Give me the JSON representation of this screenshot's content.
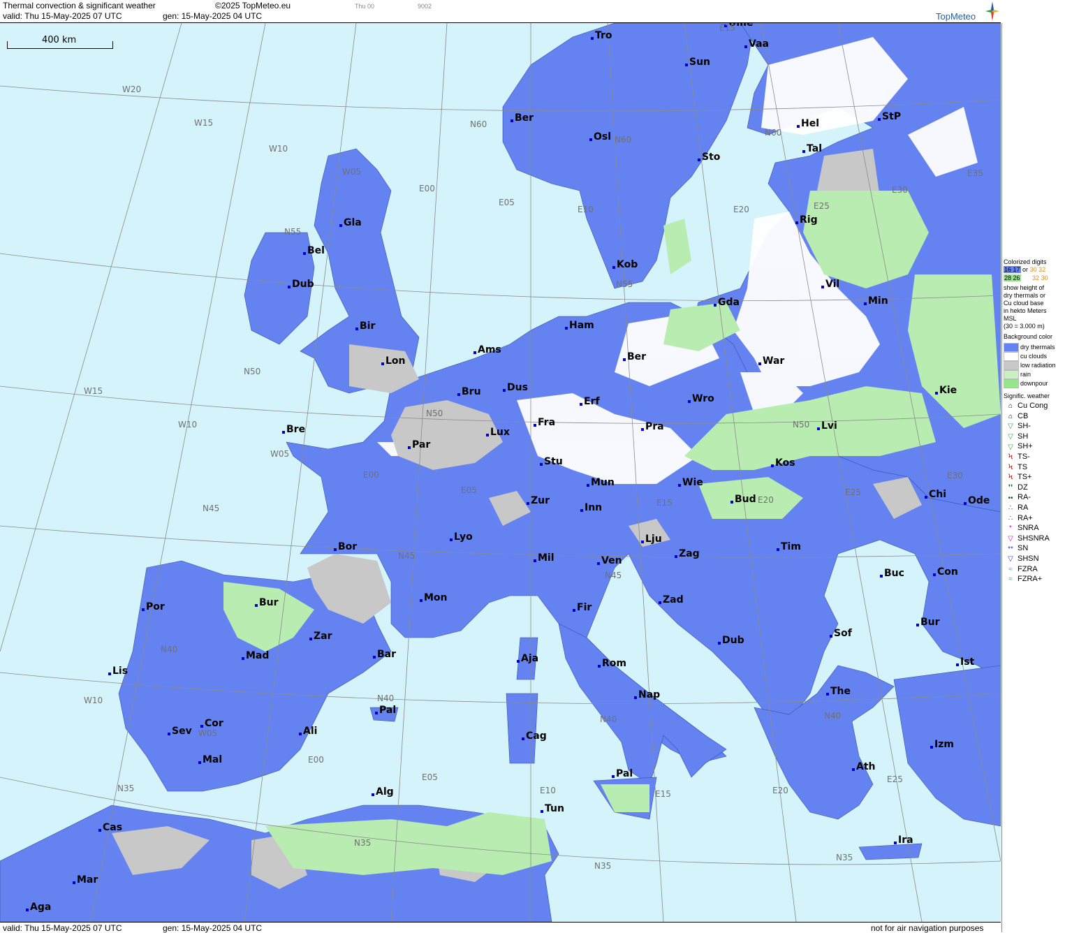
{
  "header": {
    "title": "Thermal convection & significant weather",
    "valid": "valid:  Thu   15-May-2025  07 UTC",
    "gen": "gen: 15-May-2025 04 UTC",
    "copyright": "©2025 TopMeteo.eu",
    "run": "Thu 00",
    "code": "9002",
    "logo": "TopMeteo"
  },
  "footer": {
    "valid": "valid:  Thu   15-May-2025  07 UTC",
    "gen": "gen: 15-May-2025 04 UTC",
    "disclaimer": "not for air navigation purposes"
  },
  "scale": "400 km",
  "colors": {
    "sea": "#d5f3fb",
    "dry_thermals": "#6483f0",
    "cu_clouds": "#ffffff",
    "low_radiation": "#c8c8c8",
    "rain": "#c8f0c0",
    "downpour": "#96e68c"
  },
  "legend": {
    "colorized_title": "Colorized digits",
    "digits_a": "16 17",
    "digits_or": "or",
    "digits_b": "30 32",
    "digits_c": "28 26",
    "digits_d": "32 30",
    "desc1": "show height of",
    "desc2": "dry thermals or",
    "desc3": "Cu cloud base",
    "desc4": "in hekto Meters",
    "desc5": "MSL",
    "desc6": "(30 = 3.000 m)",
    "bg_title": "Background color",
    "bg_items": [
      "dry thermals",
      "cu clouds",
      "low radiation",
      "rain",
      "downpour"
    ],
    "wx_title": "Signific. weather",
    "wx_items": [
      "Cu Cong",
      "CB",
      "SH-",
      "SH",
      "SH+",
      "TS-",
      "TS",
      "TS+",
      "DZ",
      "RA-",
      "RA",
      "RA+",
      "SNRA",
      "SHSNRA",
      "SN",
      "SHSN",
      "FZRA",
      "FZRA+"
    ]
  },
  "cities": [
    "Tro",
    "Ume",
    "Vaa",
    "Sun",
    "Ber",
    "Osl",
    "Hel",
    "StP",
    "Sto",
    "Tal",
    "Gla",
    "Bel",
    "Dub",
    "Rig",
    "Kob",
    "Gda",
    "Vil",
    "Min",
    "Bir",
    "Ham",
    "Ams",
    "Lon",
    "Ber",
    "War",
    "Dus",
    "Bru",
    "Erf",
    "Wro",
    "Kie",
    "Bre",
    "Lux",
    "Fra",
    "Pra",
    "Lvi",
    "Par",
    "Stu",
    "Kos",
    "Mun",
    "Wie",
    "Bud",
    "Chi",
    "Ode",
    "Zur",
    "Inn",
    "Lyo",
    "Lju",
    "Tim",
    "Bor",
    "Mil",
    "Ven",
    "Zag",
    "Buc",
    "Con",
    "Mon",
    "Zad",
    "Fir",
    "Por",
    "Bur",
    "Sof",
    "Bur",
    "Dub",
    "Zar",
    "Aja",
    "Ist",
    "Mad",
    "Bar",
    "Rom",
    "Lis",
    "The",
    "Nap",
    "Pal",
    "Cor",
    "Sev",
    "Ali",
    "Cag",
    "Izm",
    "Mal",
    "Ath",
    "Pal",
    "Alg",
    "Tun",
    "Cas",
    "Ira",
    "Mar",
    "Aga"
  ],
  "grid_labels": [
    "W20",
    "W15",
    "W10",
    "W05",
    "E00",
    "E05",
    "N60",
    "E10",
    "E15",
    "E20",
    "E25",
    "E30",
    "E35",
    "N55",
    "N55",
    "N50",
    "N50",
    "W15",
    "W10",
    "W05",
    "E00",
    "E05",
    "N45",
    "N45",
    "N45",
    "E15",
    "E20",
    "E25",
    "E30",
    "N40",
    "N40",
    "N40",
    "N40",
    "W10",
    "W05",
    "E00",
    "E05",
    "E10",
    "E15",
    "E20",
    "E25",
    "N35",
    "N35",
    "N35",
    "N35",
    "N60",
    "N50",
    "N60"
  ]
}
